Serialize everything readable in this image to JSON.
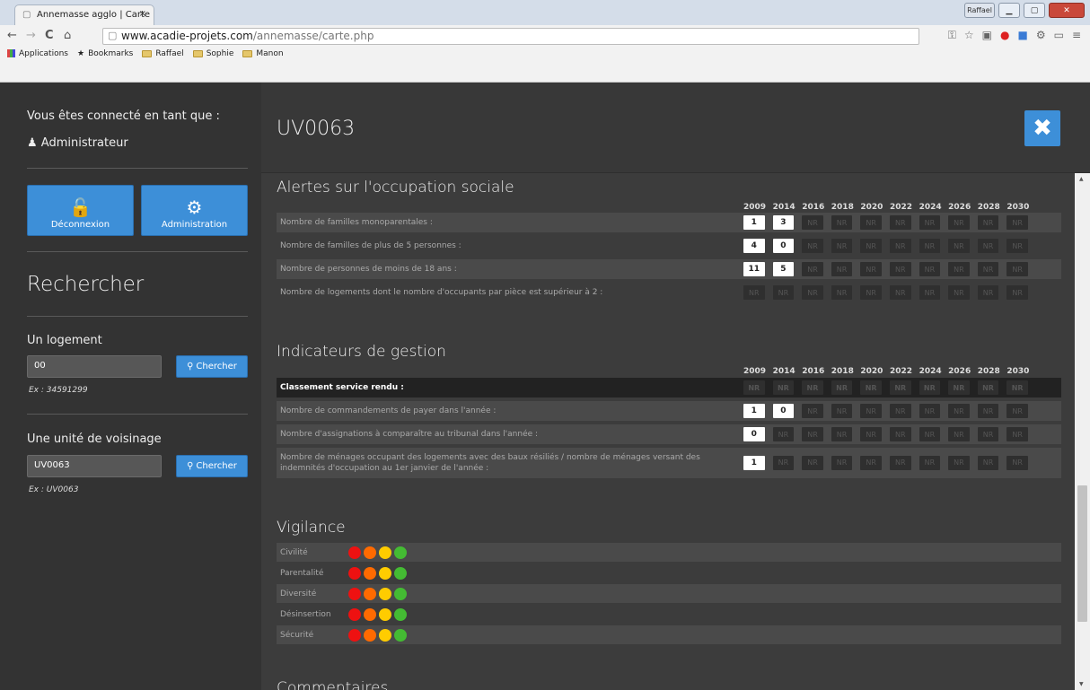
{
  "browser": {
    "tab_title": "Annemasse agglo | Carte",
    "tab_close": "×",
    "url_domain": "www.acadie-projets.com",
    "url_path": "/annemasse/carte.php",
    "window_user": "Raffael",
    "bookmarks": [
      "Applications",
      "Bookmarks",
      "Raffael",
      "Sophie",
      "Manon"
    ]
  },
  "sidebar": {
    "connected_label": "Vous êtes connecté en tant que :",
    "user": "Administrateur",
    "logout_label": "Déconnexion",
    "admin_label": "Administration",
    "search_title": "Rechercher",
    "logement_label": "Un logement",
    "logement_value": "00",
    "logement_example": "Ex : 34591299",
    "uv_label": "Une unité de voisinage",
    "uv_value": "UV0063",
    "uv_example": "Ex : UV0063",
    "search_button": "Chercher"
  },
  "main": {
    "title": "UV0063",
    "years": [
      "2009",
      "2014",
      "2016",
      "2018",
      "2020",
      "2022",
      "2024",
      "2026",
      "2028",
      "2030"
    ],
    "alertes": {
      "title": "Alertes sur l'occupation sociale",
      "rows": [
        {
          "label": "Nombre de familles monoparentales :",
          "values": [
            "1",
            "3",
            "NR",
            "NR",
            "NR",
            "NR",
            "NR",
            "NR",
            "NR",
            "NR"
          ]
        },
        {
          "label": "Nombre de familles de plus de 5 personnes :",
          "values": [
            "4",
            "0",
            "NR",
            "NR",
            "NR",
            "NR",
            "NR",
            "NR",
            "NR",
            "NR"
          ]
        },
        {
          "label": "Nombre de personnes de moins de 18 ans :",
          "values": [
            "11",
            "5",
            "NR",
            "NR",
            "NR",
            "NR",
            "NR",
            "NR",
            "NR",
            "NR"
          ]
        },
        {
          "label": "Nombre de logements dont le nombre d'occupants par pièce est supérieur à 2 :",
          "values": [
            "NR",
            "NR",
            "NR",
            "NR",
            "NR",
            "NR",
            "NR",
            "NR",
            "NR",
            "NR"
          ]
        }
      ]
    },
    "gestion": {
      "title": "Indicateurs de gestion",
      "rows": [
        {
          "label": "Classement service rendu :",
          "values": [
            "NR",
            "NR",
            "NR",
            "NR",
            "NR",
            "NR",
            "NR",
            "NR",
            "NR",
            "NR"
          ]
        },
        {
          "label": "Nombre de commandements de payer dans l'année :",
          "values": [
            "1",
            "0",
            "NR",
            "NR",
            "NR",
            "NR",
            "NR",
            "NR",
            "NR",
            "NR"
          ]
        },
        {
          "label": "Nombre d'assignations à comparaître au tribunal dans l'année :",
          "values": [
            "0",
            "NR",
            "NR",
            "NR",
            "NR",
            "NR",
            "NR",
            "NR",
            "NR",
            "NR"
          ]
        },
        {
          "label": "Nombre de ménages occupant des logements avec des baux résiliés / nombre de ménages versant des indemnités d'occupation au 1er janvier de l'année :",
          "values": [
            "1",
            "NR",
            "NR",
            "NR",
            "NR",
            "NR",
            "NR",
            "NR",
            "NR",
            "NR"
          ]
        }
      ]
    },
    "vigilance": {
      "title": "Vigilance",
      "rows": [
        "Civilité",
        "Parentalité",
        "Diversité",
        "Désinsertion",
        "Sécurité"
      ],
      "colors": [
        "#ee1111",
        "#ff6a00",
        "#ffcc00",
        "#44bb33"
      ]
    },
    "commentaires_title": "Commentaires"
  }
}
